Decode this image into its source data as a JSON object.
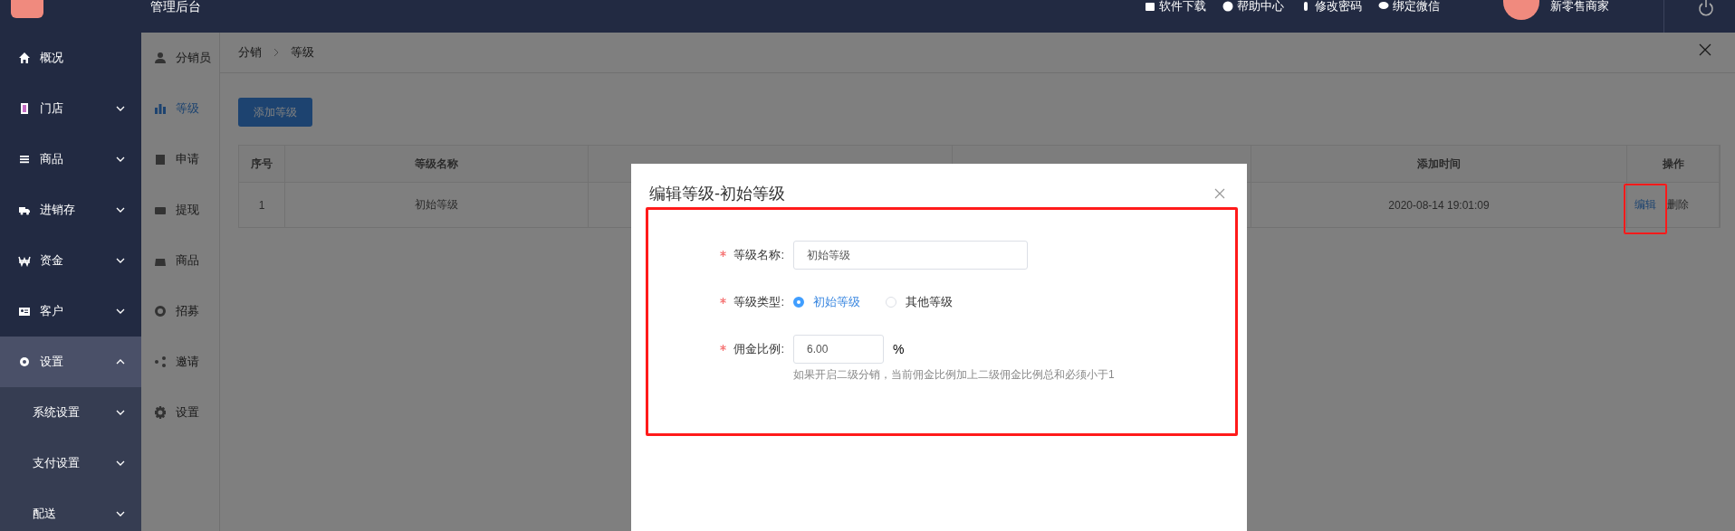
{
  "topbar": {
    "title": "管理后台",
    "links": [
      {
        "label": "软件下载"
      },
      {
        "label": "帮助中心"
      },
      {
        "label": "修改密码"
      },
      {
        "label": "绑定微信"
      }
    ],
    "user": "新零售商家"
  },
  "sidebar": {
    "items": [
      {
        "label": "概况",
        "kind": "link",
        "expanded": false
      },
      {
        "label": "门店",
        "kind": "group",
        "expanded": false
      },
      {
        "label": "商品",
        "kind": "group",
        "expanded": false
      },
      {
        "label": "进销存",
        "kind": "group",
        "expanded": false
      },
      {
        "label": "资金",
        "kind": "group",
        "expanded": false
      },
      {
        "label": "客户",
        "kind": "group",
        "expanded": false
      },
      {
        "label": "设置",
        "kind": "group",
        "expanded": true,
        "children": [
          {
            "label": "系统设置",
            "expanded": false
          },
          {
            "label": "支付设置",
            "expanded": false
          },
          {
            "label": "配送",
            "expanded": false
          }
        ]
      }
    ]
  },
  "subnav": {
    "items": [
      {
        "label": "分销员",
        "selected": false
      },
      {
        "label": "等级",
        "selected": true
      },
      {
        "label": "申请",
        "selected": false
      },
      {
        "label": "提现",
        "selected": false
      },
      {
        "label": "商品",
        "selected": false
      },
      {
        "label": "招募",
        "selected": false
      },
      {
        "label": "邀请",
        "selected": false
      },
      {
        "label": "设置",
        "selected": false
      }
    ]
  },
  "breadcrumb": [
    "分销",
    "等级"
  ],
  "add_button": "添加等级",
  "table": {
    "columns": [
      {
        "label": "序号"
      },
      {
        "label": "等级名称"
      },
      {
        "label": "添加时间"
      },
      {
        "label": "操作"
      }
    ],
    "rows": [
      {
        "cells": [
          "1",
          "初始等级",
          "2020-08-14 19:01:09"
        ],
        "actions": [
          {
            "label": "编辑",
            "kind": "edit"
          },
          {
            "label": "删除",
            "kind": "delete"
          }
        ]
      }
    ]
  },
  "modal": {
    "title": "编辑等级-初始等级",
    "fields": [
      {
        "kind": "text",
        "label": "等级名称:",
        "required": true,
        "value": "初始等级"
      },
      {
        "kind": "radio",
        "label": "等级类型:",
        "required": true,
        "options": [
          {
            "label": "初始等级",
            "selected": true
          },
          {
            "label": "其他等级",
            "selected": false
          }
        ]
      },
      {
        "kind": "number",
        "label": "佣金比例:",
        "required": true,
        "value": "6.00",
        "unit": "%",
        "hint": "如果开启二级分销，当前佣金比例加上二级佣金比例总和必须小于1"
      }
    ]
  }
}
